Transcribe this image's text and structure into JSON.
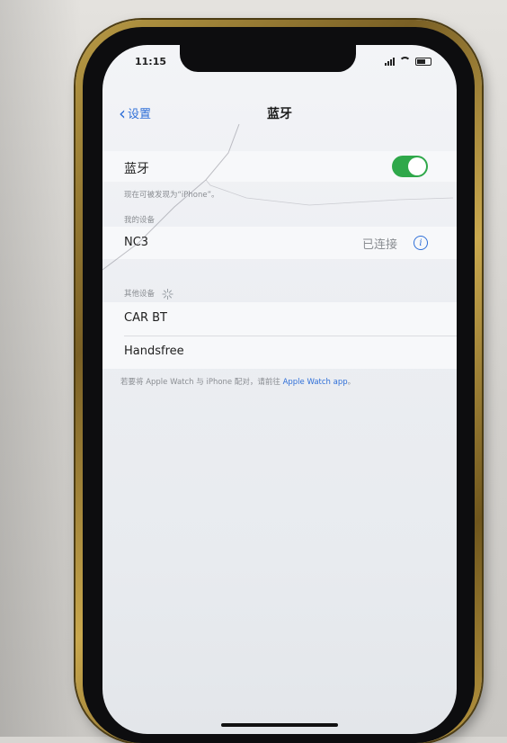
{
  "status_bar": {
    "time": "11:15",
    "icons": [
      "signal-icon",
      "wifi-icon",
      "battery-icon"
    ]
  },
  "navbar": {
    "back_label": "设置",
    "title": "蓝牙"
  },
  "bluetooth": {
    "label": "蓝牙",
    "toggle_on": true,
    "discoverable_text": "现在可被发现为“iPhone”。"
  },
  "my_devices": {
    "header": "我的设备",
    "items": [
      {
        "name": "NC3",
        "status": "已连接"
      }
    ]
  },
  "other_devices": {
    "header": "其他设备",
    "items": [
      {
        "name": "CAR BT"
      },
      {
        "name": "Handsfree"
      }
    ]
  },
  "footnote": {
    "prefix": "若要将 Apple Watch 与 iPhone 配对，请前往 ",
    "link": "Apple Watch app",
    "suffix": "。"
  },
  "colors": {
    "accent": "#2f6fd8",
    "toggle_on": "#2fa84a",
    "phone_frame": "#b89a45"
  }
}
